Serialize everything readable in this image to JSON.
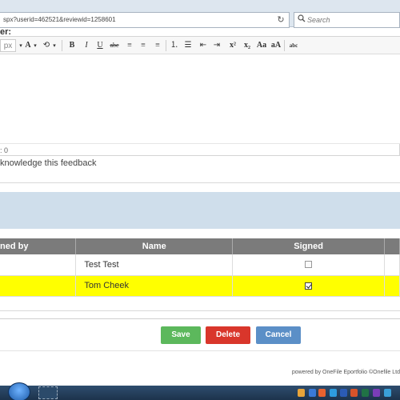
{
  "browser": {
    "url": "spx?userid=462521&reviewid=1258601",
    "search_placeholder": "Search",
    "refresh_icon": "refresh-icon",
    "search_icon": "magnifier-icon"
  },
  "form": {
    "field_label": "er:",
    "word_count": ": 0",
    "acknowledge_text": "knowledge this feedback"
  },
  "toolbar": {
    "font_size": "px",
    "font_color": "A",
    "bold": "B",
    "italic": "I",
    "underline": "U",
    "strike": "abc",
    "superscript": "x²",
    "subscript": "x₂",
    "case_aa": "Aa",
    "grow": "aA",
    "spellcheck": "abc"
  },
  "table": {
    "headers": [
      "ned by",
      "Name",
      "Signed",
      ""
    ],
    "rows": [
      {
        "name": "Test Test",
        "signed": false,
        "highlight": false
      },
      {
        "name": "Tom Cheek",
        "signed": true,
        "highlight": true
      }
    ]
  },
  "buttons": {
    "save": "Save",
    "delete": "Delete",
    "cancel": "Cancel"
  },
  "footer": "powered by OneFile Eportfolio ©Onefile Ltd",
  "colors": {
    "save": "#5cb85c",
    "delete": "#d9362b",
    "cancel": "#5b8fc7",
    "highlight": "#ffff00",
    "header": "#7b7b7b"
  }
}
